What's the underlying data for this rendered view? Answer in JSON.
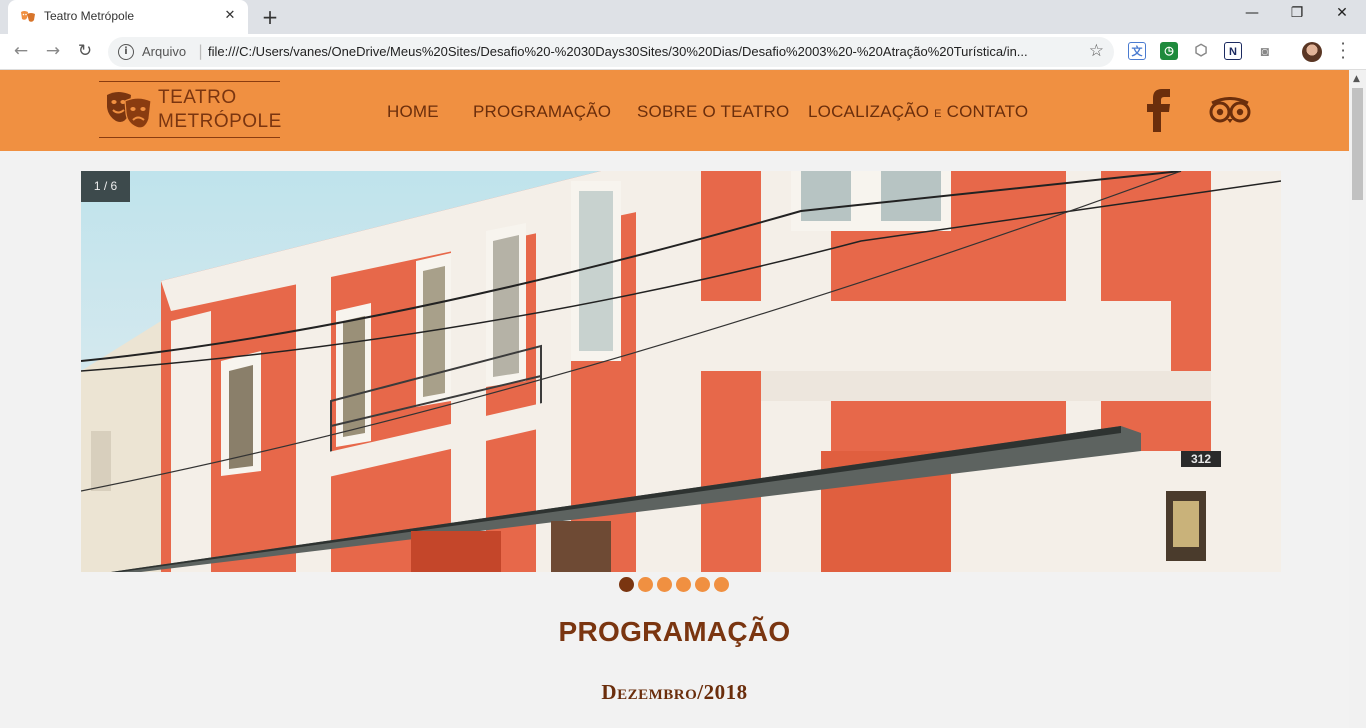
{
  "browser": {
    "tab_title": "Teatro Metrópole",
    "tab_close": "✕",
    "new_tab": "+",
    "window_controls": {
      "minimize": "—",
      "maximize": "❐",
      "close": "✕"
    },
    "url_scheme": "Arquivo",
    "url": "file:///C:/Users/vanes/OneDrive/Meus%20Sites/Desafio%20-%2030Days30Sites/30%20Dias/Desafio%2003%20-%20Atração%20Turística/in...",
    "extensions": [
      "translate-icon",
      "clock-icon",
      "shield-icon",
      "notion-icon",
      "camera-icon"
    ]
  },
  "site": {
    "logo": {
      "line1": "TEATRO",
      "line2": "METRÓPOLE"
    },
    "nav": {
      "home": "HOME",
      "programacao": "PROGRAMAÇÃO",
      "sobre": "SOBRE O TEATRO",
      "localizacao": "LOCALIZAÇÃO",
      "e": "E",
      "contato": "CONTATO"
    },
    "social": [
      "facebook-icon",
      "tripadvisor-icon"
    ],
    "slider": {
      "counter": "1 / 6",
      "total_slides": 6,
      "active_slide": 1,
      "building_number": "312"
    },
    "section_title": "PROGRAMAÇÃO",
    "month": "Dezembro/2018"
  },
  "colors": {
    "header_orange": "#f09041",
    "brown_dark": "#7a3510",
    "page_bg": "#f2f2f2",
    "facade_orange": "#e7684a"
  }
}
